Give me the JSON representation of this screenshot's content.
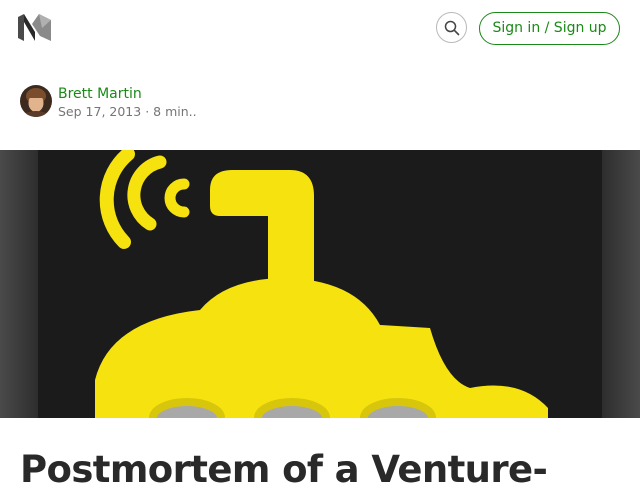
{
  "header": {
    "logo_icon": "medium-logo-icon",
    "search_icon": "search-icon",
    "signin_label": "Sign in / Sign up",
    "accent_color": "#1a8917"
  },
  "author": {
    "name": "Brett Martin",
    "date": "Sep 17, 2013",
    "separator": "·",
    "read_time": "8 min.."
  },
  "hero": {
    "image_icon": "yellow-submarine-broadcast-icon",
    "colors": {
      "background": "#1f1f1f",
      "frame": "#3a3a3a",
      "submarine": "#f5e20f"
    }
  },
  "article": {
    "title": "Postmortem of a Venture-"
  }
}
